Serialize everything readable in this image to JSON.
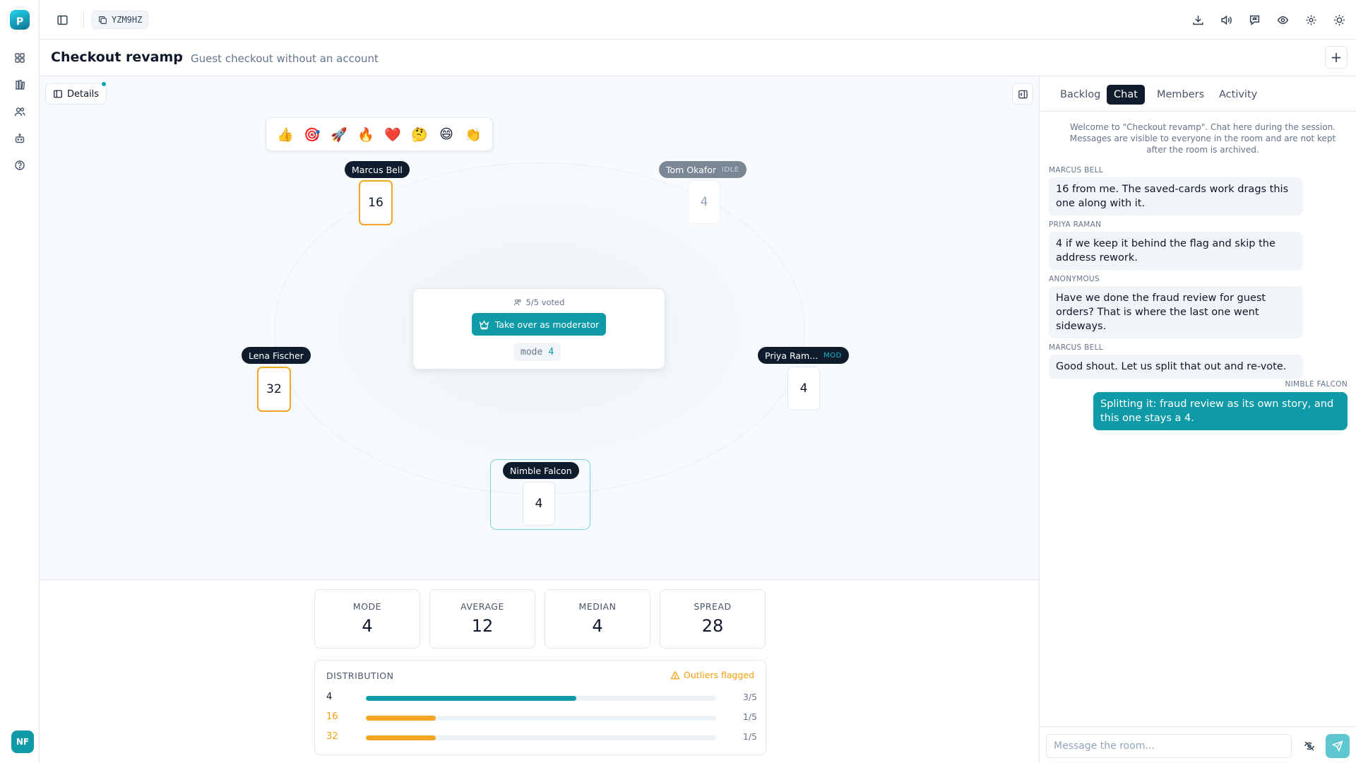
{
  "app": {
    "logo_letter": "P",
    "user_initials": "NF",
    "accent": "#0e9aa7",
    "outlier_color": "#f5a524"
  },
  "topbar": {
    "room_code": "YZM9HZ",
    "icons": [
      "sidebar-toggle-icon",
      "copy-icon",
      "download-icon",
      "volume-icon",
      "comment-flag-icon",
      "eye-icon",
      "gear-icon",
      "sun-icon"
    ]
  },
  "rail": {
    "icons": [
      "dashboard-icon",
      "library-icon",
      "users-icon",
      "robot-icon",
      "help-icon"
    ]
  },
  "header": {
    "title": "Checkout revamp",
    "separator": "·",
    "subtitle": "Guest checkout without an account",
    "add_label": "+"
  },
  "table": {
    "details_label": "Details",
    "reactions": [
      "👍",
      "🎯",
      "🚀",
      "🔥",
      "❤️",
      "🤔",
      "😄",
      "👏"
    ],
    "players": [
      {
        "name": "Marcus Bell",
        "vote": "16",
        "badge": "",
        "status": "outlier"
      },
      {
        "name": "Tom Okafor",
        "vote": "4",
        "badge": "IDLE",
        "status": "idle"
      },
      {
        "name": "Lena Fischer",
        "vote": "32",
        "badge": "",
        "status": "outlier"
      },
      {
        "name": "Priya Ram...",
        "vote": "4",
        "badge": "MOD",
        "status": "normal"
      },
      {
        "name": "Nimble Falcon",
        "vote": "4",
        "badge": "",
        "status": "self"
      }
    ],
    "center": {
      "voted": "5/5 voted",
      "takeover_label": "Take over as moderator",
      "mode_label": "mode",
      "mode_value": "4"
    }
  },
  "stats": {
    "cards": [
      {
        "label": "MODE",
        "value": "4"
      },
      {
        "label": "AVERAGE",
        "value": "12"
      },
      {
        "label": "MEDIAN",
        "value": "4"
      },
      {
        "label": "SPREAD",
        "value": "28"
      }
    ],
    "distribution": {
      "title": "DISTRIBUTION",
      "flag": "Outliers flagged",
      "rows": [
        {
          "value": "4",
          "count": "3/5",
          "fraction": 0.6,
          "outlier": false
        },
        {
          "value": "16",
          "count": "1/5",
          "fraction": 0.2,
          "outlier": true
        },
        {
          "value": "32",
          "count": "1/5",
          "fraction": 0.2,
          "outlier": true
        }
      ]
    }
  },
  "chat": {
    "tabs": [
      "Backlog",
      "Chat",
      "Members",
      "Activity"
    ],
    "active_tab": "Chat",
    "welcome": "Welcome to \"Checkout revamp\". Chat here during the session. Messages are visible to everyone in the room and are not kept after the room is archived.",
    "messages": [
      {
        "author": "MARCUS BELL",
        "text": "16 from me. The saved-cards work drags this one along with it.",
        "mine": false
      },
      {
        "author": "PRIYA RAMAN",
        "text": "4 if we keep it behind the flag and skip the address rework.",
        "mine": false
      },
      {
        "author": "ANONYMOUS",
        "text": "Have we done the fraud review for guest orders? That is where the last one went sideways.",
        "mine": false
      },
      {
        "author": "MARCUS BELL",
        "text": "Good shout. Let us split that out and re-vote.",
        "mine": false
      },
      {
        "author": "NIMBLE FALCON",
        "text": "Splitting it: fraud review as its own story, and this one stays a 4.",
        "mine": true
      }
    ],
    "input_placeholder": "Message the room..."
  }
}
